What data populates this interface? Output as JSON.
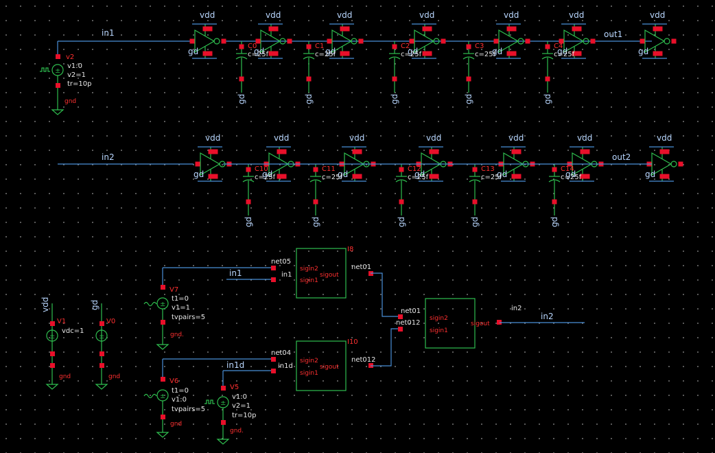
{
  "labels": {
    "vdd": "vdd",
    "gd": "gd",
    "gnd": "gnd",
    "gnd_dot": "gnd.",
    "in1": "in1",
    "in2": "in2",
    "in1d": "in1d",
    "out1": "out1",
    "out2": "out2"
  },
  "sources": {
    "v2": {
      "name": "v2",
      "line1": "v1:0",
      "line2": "v2=1",
      "line3": "tr=10p",
      "ground": "gnd"
    },
    "v5": {
      "name": "V5",
      "line1": "v1:0",
      "line2": "v2=1",
      "line3": "tr=10p",
      "ground": "gnd."
    },
    "v7": {
      "name": "V7",
      "line1": "t1=0",
      "line2": "v1=1",
      "line3": "tvpairs=5",
      "ground": "gnd."
    },
    "v6": {
      "name": "V6",
      "line1": "t1=0",
      "line2": "v1:0",
      "line3": "tvpairs=5",
      "ground": "gnd"
    },
    "v1": {
      "name": "V1",
      "line1": "vdc=1",
      "ground": "gnd"
    },
    "v0": {
      "name": "V0",
      "ground": "gnd"
    }
  },
  "caps_row1": [
    {
      "name": "C0",
      "value": "c=25f"
    },
    {
      "name": "C1",
      "value": "c=25f"
    },
    {
      "name": "C2",
      "value": "c=25f"
    },
    {
      "name": "C3",
      "value": "c=25f"
    },
    {
      "name": "C4",
      "value": "c=25f"
    }
  ],
  "caps_row2": [
    {
      "name": "C10",
      "value": "c=25f"
    },
    {
      "name": "C11",
      "value": "c=25f"
    },
    {
      "name": "C12",
      "value": "c=25f"
    },
    {
      "name": "C13",
      "value": "c=25f"
    },
    {
      "name": "C14",
      "value": "c=25f"
    }
  ],
  "blocks": {
    "i8": {
      "name": "I8",
      "in_top": "sigin2",
      "in_bottom": "sigin1",
      "out": "sigout",
      "net_top": "net05",
      "net_bottom": "in1",
      "net_out": "net01"
    },
    "i10": {
      "name": "I10",
      "in_top": "sigin2",
      "in_bottom": "sigin1",
      "out": "sigout",
      "net_top": "net04",
      "net_bottom": "in1d",
      "net_out": "net012"
    },
    "mux": {
      "in_top": "sigin2",
      "in_bottom": "sigin1",
      "out": "sigout",
      "net_top": "net01",
      "net_bottom": "net012",
      "net_out_small": "in2",
      "net_out": "in2"
    }
  }
}
